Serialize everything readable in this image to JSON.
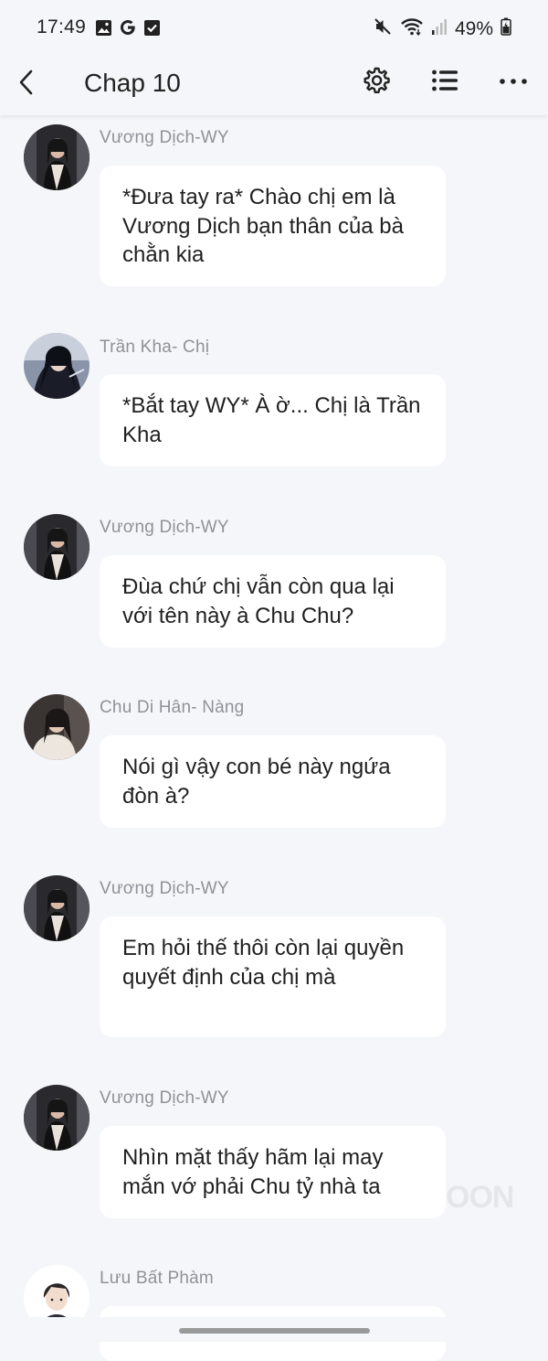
{
  "status_bar": {
    "time": "17:49",
    "battery": "49%",
    "left_icons": [
      "image-icon",
      "google-icon",
      "checkbox-icon"
    ],
    "right_icons": [
      "mute-icon",
      "wifi-icon",
      "signal-icon",
      "battery-icon"
    ]
  },
  "app_bar": {
    "title": "Chap 10",
    "icons": [
      "back-icon",
      "settings-icon",
      "list-icon",
      "more-icon"
    ]
  },
  "messages": [
    {
      "sender": "Vương Dịch-WY",
      "text": "*Đưa tay ra* Chào chị em là Vương Dịch bạn thân của bà chằn kia"
    },
    {
      "sender": "Trần Kha- Chị",
      "text": "*Bắt tay WY* À ờ... Chị là Trần Kha"
    },
    {
      "sender": "Vương Dịch-WY",
      "text": "Đùa chứ chị vẫn còn qua lại với tên này à Chu Chu?"
    },
    {
      "sender": "Chu Di Hân- Nàng",
      "text": "Nói gì vậy con bé này ngứa đòn à?"
    },
    {
      "sender": "Vương Dịch-WY",
      "text": "Em hỏi thế thôi còn lại quyền quyết định của chị mà"
    },
    {
      "sender": "Vương Dịch-WY",
      "text": "Nhìn mặt thấy hãm lại may mắn vớ phải Chu tỷ nhà ta"
    },
    {
      "sender": "Lưu Bất Phàm",
      "text": ""
    }
  ],
  "watermark": "OON",
  "colors": {
    "background": "#f5f6f9",
    "bubble": "#ffffff",
    "sender_text": "#8f9299",
    "message_text": "#1f1f1f"
  }
}
